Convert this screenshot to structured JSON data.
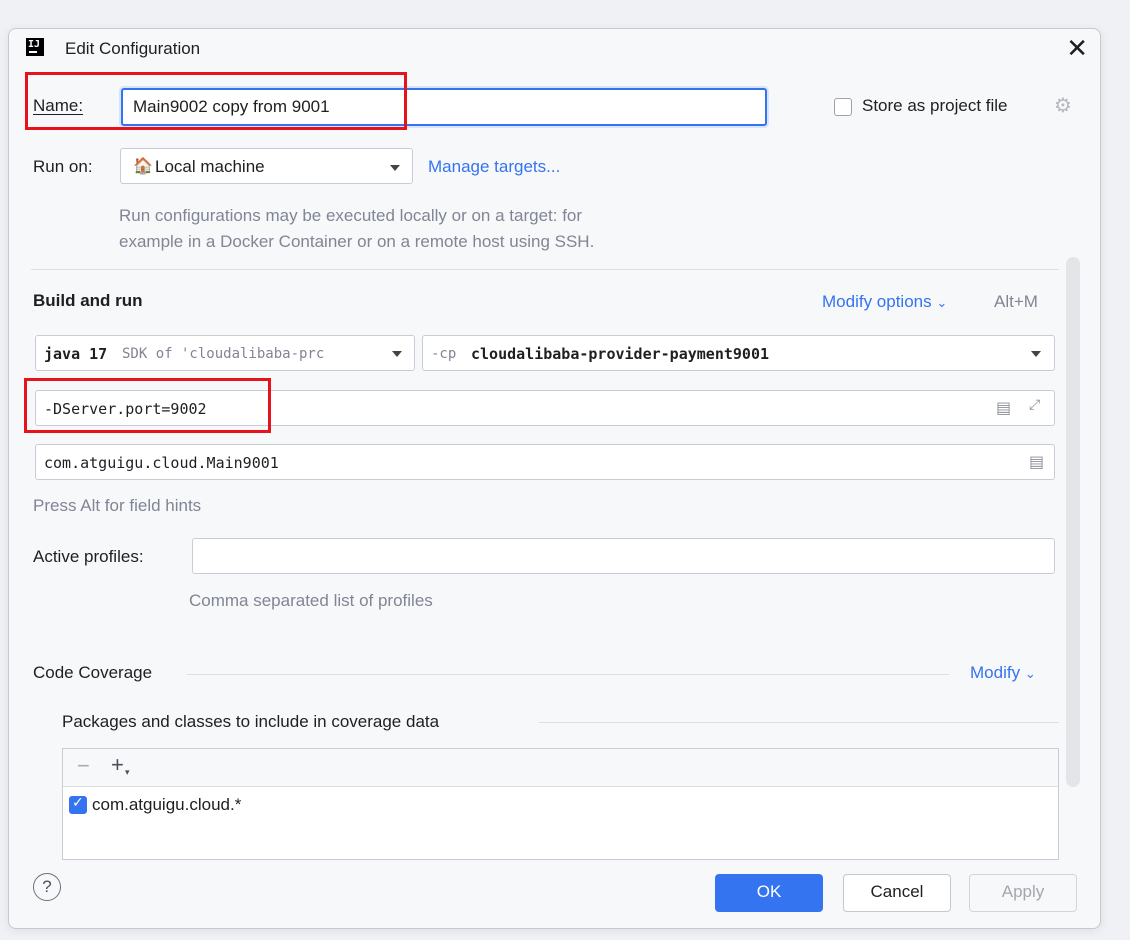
{
  "window": {
    "title": "Edit Configuration",
    "logo_text": "IJ"
  },
  "name": {
    "label": "Name:",
    "value": "Main9002 copy from 9001"
  },
  "store": {
    "label": "Store as project file"
  },
  "run_on": {
    "label": "Run on:",
    "value": "Local machine",
    "manage_link": "Manage targets...",
    "hint_line1": "Run configurations may be executed locally or on a target: for",
    "hint_line2": "example in a Docker Container or on a remote host using SSH."
  },
  "build": {
    "title": "Build and run",
    "modify_label": "Modify options",
    "modify_shortcut": "Alt+M",
    "jdk_strong": "java 17",
    "jdk_muted": "SDK of 'cloudalibaba-prc",
    "cp_prefix": "-cp",
    "cp_value": "cloudalibaba-provider-payment9001",
    "vm_options": "-DServer.port=9002",
    "main_class": "com.atguigu.cloud.Main9001",
    "field_hint": "Press Alt for field hints"
  },
  "profiles": {
    "label": "Active profiles:",
    "value": "",
    "hint": "Comma separated list of profiles"
  },
  "coverage": {
    "title": "Code Coverage",
    "modify_label": "Modify",
    "packages_title": "Packages and classes to include in coverage data",
    "items": [
      {
        "label": "com.atguigu.cloud.*",
        "checked": true
      }
    ]
  },
  "buttons": {
    "help": "?",
    "ok": "OK",
    "cancel": "Cancel",
    "apply": "Apply"
  },
  "colors": {
    "accent": "#3574f0",
    "highlight": "#e6131c"
  }
}
